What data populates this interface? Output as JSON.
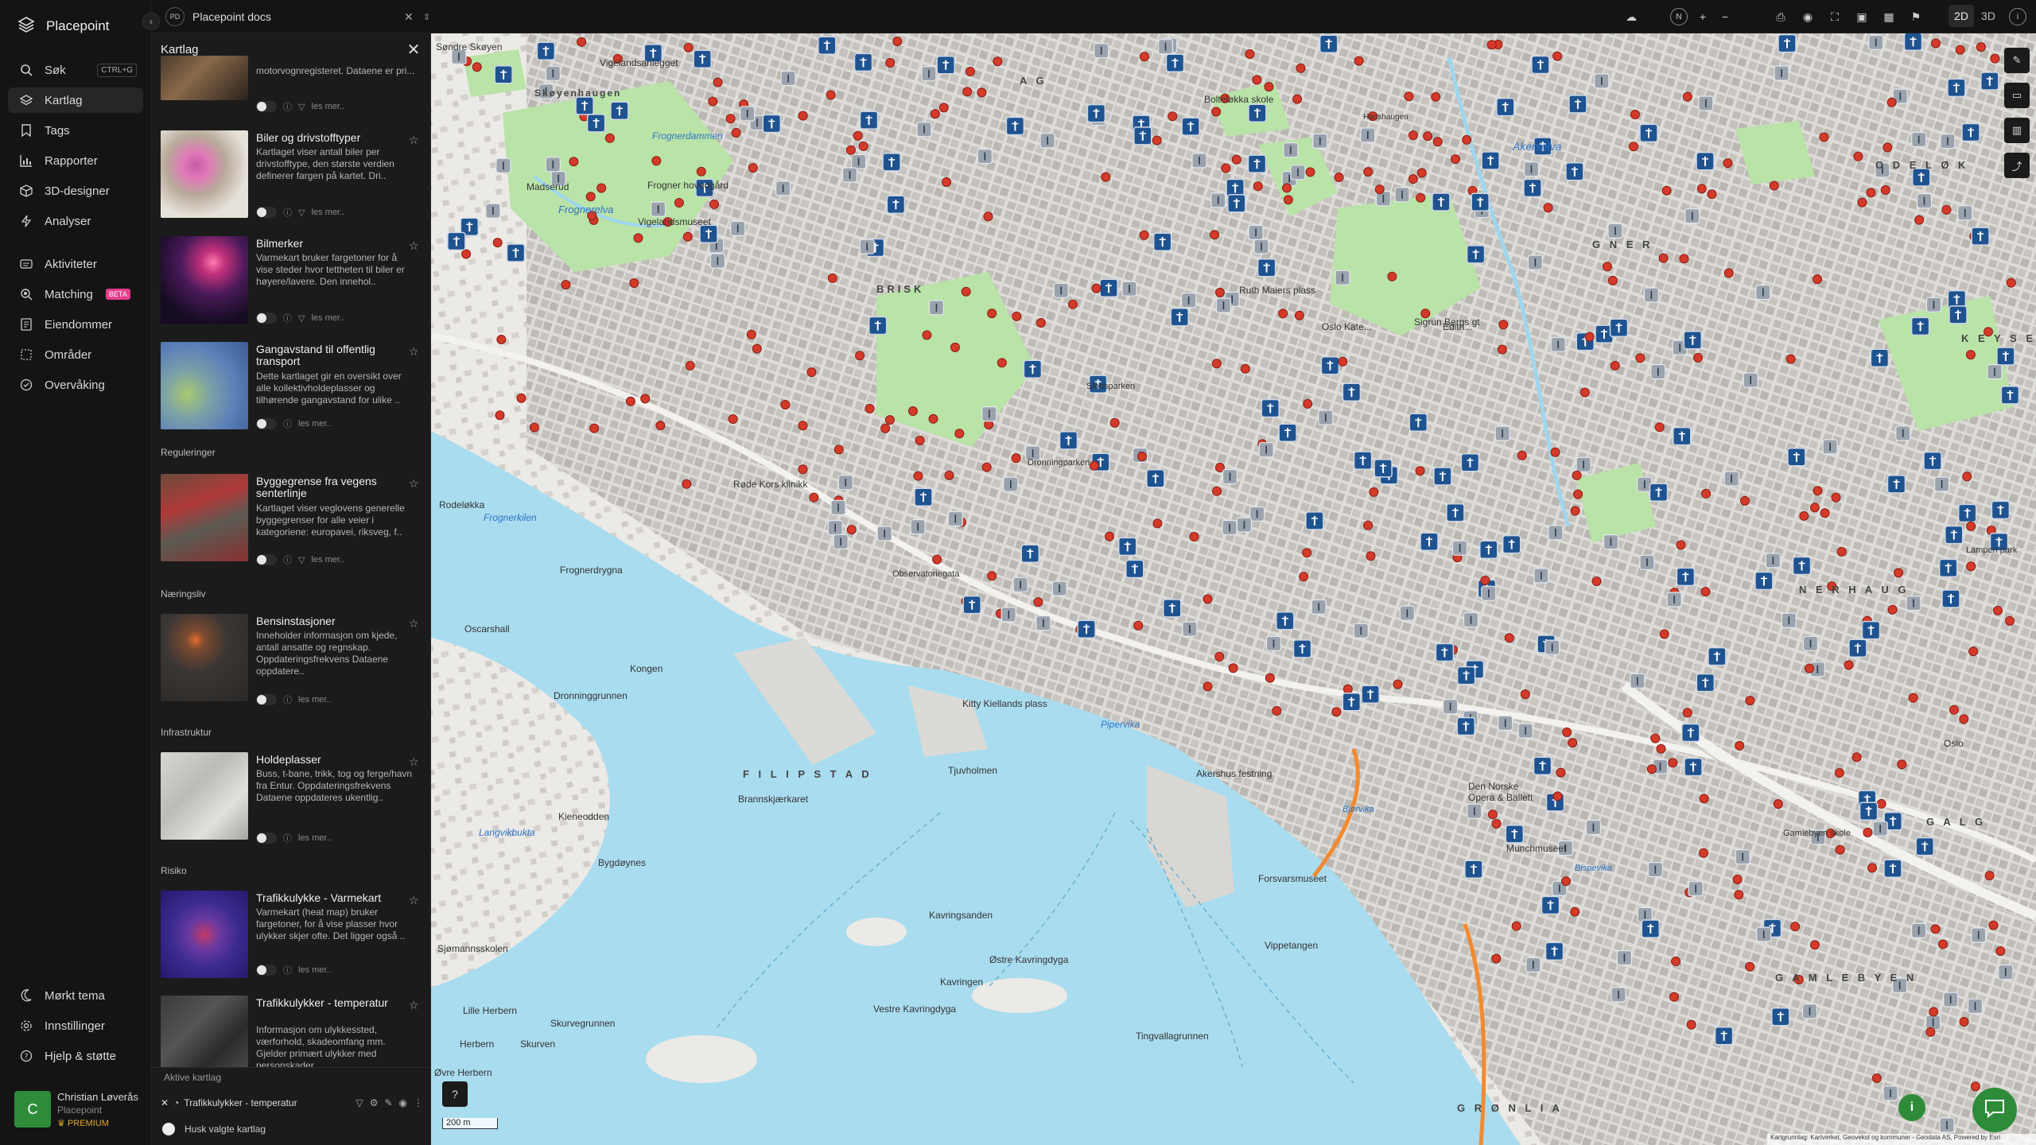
{
  "app": {
    "name": "Placepoint"
  },
  "nav": {
    "items": [
      {
        "label": "Søk",
        "icon": "search-icon",
        "shortcut": "CTRL+G"
      },
      {
        "label": "Kartlag",
        "icon": "layers-icon",
        "active": true
      },
      {
        "label": "Tags",
        "icon": "bookmark-icon"
      },
      {
        "label": "Rapporter",
        "icon": "chart-icon"
      },
      {
        "label": "3D-designer",
        "icon": "cube-icon"
      },
      {
        "label": "Analyser",
        "icon": "bolt-icon"
      },
      {
        "label": "Aktiviteter",
        "icon": "activity-icon"
      },
      {
        "label": "Matching",
        "icon": "matching-icon",
        "badge": "BETA"
      },
      {
        "label": "Eiendommer",
        "icon": "document-icon"
      },
      {
        "label": "Områder",
        "icon": "area-icon"
      },
      {
        "label": "Overvåking",
        "icon": "monitor-icon"
      }
    ],
    "bottom": [
      {
        "label": "Mørkt tema",
        "icon": "moon-icon"
      },
      {
        "label": "Innstillinger",
        "icon": "gear-icon"
      },
      {
        "label": "Hjelp & støtte",
        "icon": "help-icon"
      }
    ],
    "user": {
      "initial": "C",
      "name": "Christian Løverås",
      "org": "Placepoint",
      "plan": "PREMIUM"
    }
  },
  "topbar": {
    "doc_badge": "PD",
    "doc_title": "Placepoint docs",
    "compass": "N",
    "mode_2d": "2D",
    "mode_3d": "3D"
  },
  "panel": {
    "title": "Kartlag",
    "read_more": "les mer..",
    "top_partial_desc": "motorvognregisteret. Dataene er pri...",
    "sections": {
      "reg": "Reguleringer",
      "naering": "Næringsliv",
      "infra": "Infrastruktur",
      "risiko": "Risiko"
    },
    "cards": [
      {
        "title": "Biler og drivstofftyper",
        "desc": "Kartlaget viser antall biler per drivstofftype, den største verdien definerer fargen på kartet. Dri..",
        "filter": true
      },
      {
        "title": "Bilmerker",
        "desc": "Varmekart bruker fargetoner for å vise steder hvor tettheten til biler er høyere/lavere. Den innehol..",
        "filter": true
      },
      {
        "title": "Gangavstand til offentlig transport",
        "desc": "Dette kartlaget gir en oversikt over alle kollektivholdeplasser og tilhørende gangavstand for ulike ..",
        "filter": false
      },
      {
        "title": "Byggegrense fra vegens senterlinje",
        "desc": "Kartlaget viser veglovens generelle byggegrenser for alle veier i kategoriene: europavei, riksveg, f..",
        "filter": true
      },
      {
        "title": "Bensinstasjoner",
        "desc": "Inneholder informasjon om kjede, antall ansatte og regnskap. Oppdateringsfrekvens Dataene oppdatere..",
        "filter": false
      },
      {
        "title": "Holdeplasser",
        "desc": "Buss, t-bane, trikk, tog og ferge/havn fra Entur. Oppdateringsfrekvens Dataene oppdateres ukentlig..",
        "filter": false
      },
      {
        "title": "Trafikkulykke - Varmekart",
        "desc": "Varmekart (heat map) bruker fargetoner, for å vise plasser hvor ulykker skjer ofte. Det ligger også ..",
        "filter": false
      },
      {
        "title": "Trafikkulykker - temperatur",
        "desc": "Informasjon om ulykkessted, værforhold, skadeomfang mm. Gjelder primært ulykker med personskader.",
        "filter": false
      }
    ],
    "active_header": "Aktive kartlag",
    "active_layer": "Trafikkulykker - temperatur",
    "remember": "Husk valgte kartlag"
  },
  "map": {
    "scale": "200 m",
    "attribution": "Kartgrunnlag: Kartverket, Geovekst og kommuner - Geodata AS, Powered by Esri",
    "places": {
      "sondre_skoyen": "Søndre Skøyen",
      "skoyenhaugen": "Skøyenhaugen",
      "madserud": "Madserud",
      "frognerdammen": "Frognerdammen",
      "frognerelva": "Frognerelva",
      "frogner_hovedgard": "Frogner hovedgård",
      "vigelandsanlegget": "Vigelandsanlegget",
      "vigelandsmuseet": "Vigelandsmuseet",
      "brisk": "BRISK",
      "ag": "A G",
      "bolteloekka": "Bolteløkka skole",
      "haugen": "Hanshaugen",
      "akerselva": "Akerselva",
      "odelok": "O D E L Ø K",
      "gner": "G N E R",
      "keyser": "K E Y S E R",
      "ruth_maiers": "Ruth Maiers plass",
      "oslo_kate": "Oslo Kate...",
      "sigrun_bergs": "Sigrun Bergs gt",
      "slottsparken": "Slottsparken",
      "dronningparken": "Dronningparken",
      "rodelokka": "Rodeløkka",
      "frognerkilen": "Frognerkilen",
      "frognerdrygna": "Frognerdrygna",
      "rode_kors": "Røde Kors klinikk",
      "oscarshall": "Oscarshall",
      "kongen": "Kongen",
      "dronningrunnen": "Dronninggrunnen",
      "filipstad": "F I L I P S T A D",
      "kitty": "Kitty Kiellands plass",
      "pipervika": "Pipervika",
      "tjuvholmen": "Tjuvholmen",
      "brannskjaer": "Brannskjærkaret",
      "kieneodden": "Kieneodden",
      "langvikbukta": "Langvikbukta",
      "bygdoynes": "Bygdøynes",
      "akershus": "Akershus festning",
      "den_norske": "Den Norske Opera & Ballett",
      "bjorvika": "Bjørvika",
      "munchmuseet": "Munchmuseet",
      "bispevika": "Bispevika",
      "sjomannsskolen": "Sjømannsskolen",
      "kavringsanden": "Kavringsanden",
      "kavringen": "Kavringen",
      "ostre_kavringdyga": "Østre Kavringdyga",
      "vestre_kavringdyga": "Vestre Kavringdyga",
      "forsvarsmuseet": "Forsvarsmuseet",
      "vippetangen": "Vippetangen",
      "lille_herbern": "Lille Herbern",
      "herbern": "Herbern",
      "skurven": "Skurven",
      "skurvegrunnen": "Skurvegrunnen",
      "tingvallagrunnen": "Tingvallagrunnen",
      "gamlebyen": "G A M L E B Y E N",
      "gronlia": "G R Ø N L I A",
      "ovre_herbern": "Øvre Herbern",
      "nerhauc": "N E R H A U G",
      "edith": "Edith...",
      "observatorie": "Observatoriegata",
      "gamlebyen_skole": "Gamlebyen skole",
      "oslo": "Oslo",
      "galg": "G A L G",
      "lampen": "Lampen park"
    }
  }
}
